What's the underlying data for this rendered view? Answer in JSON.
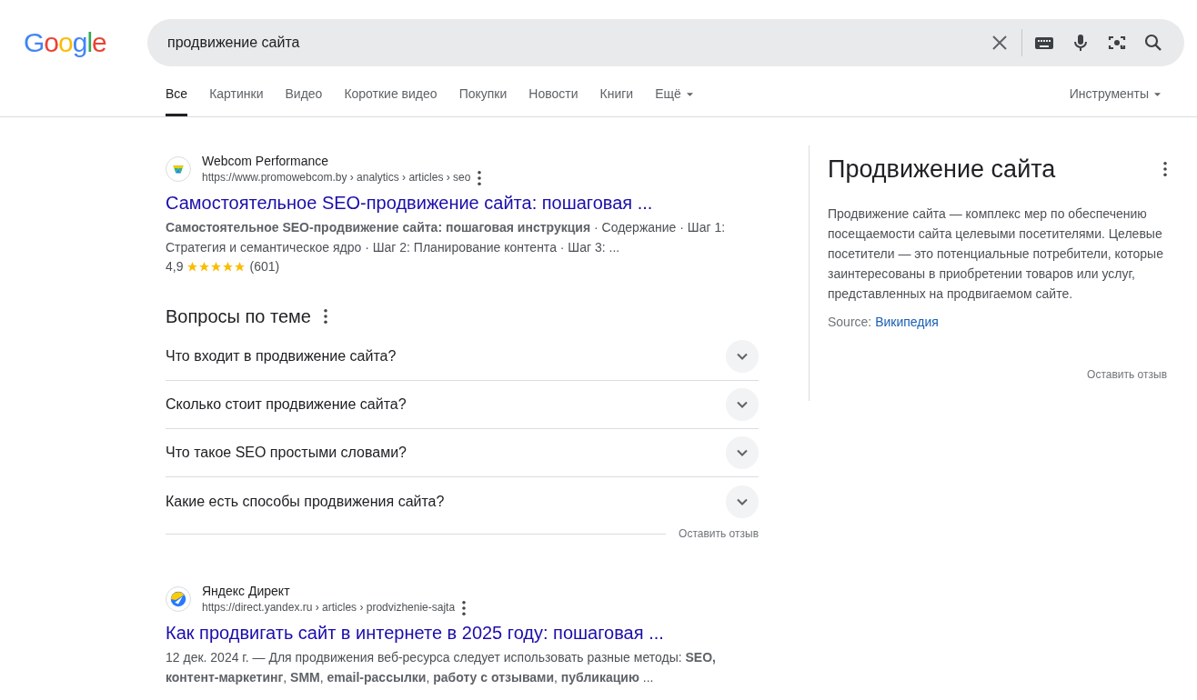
{
  "logo": {
    "text": "Google"
  },
  "search": {
    "value": "продвижение сайта"
  },
  "tabs": [
    {
      "label": "Все",
      "selected": true,
      "dropdown": false
    },
    {
      "label": "Картинки",
      "selected": false,
      "dropdown": false
    },
    {
      "label": "Видео",
      "selected": false,
      "dropdown": false
    },
    {
      "label": "Короткие видео",
      "selected": false,
      "dropdown": false
    },
    {
      "label": "Покупки",
      "selected": false,
      "dropdown": false
    },
    {
      "label": "Новости",
      "selected": false,
      "dropdown": false
    },
    {
      "label": "Книги",
      "selected": false,
      "dropdown": false
    },
    {
      "label": "Ещё",
      "selected": false,
      "dropdown": true
    }
  ],
  "tools": {
    "label": "Инструменты"
  },
  "results": [
    {
      "site": "Webcom Performance",
      "url": "https://www.promowebcom.by › analytics › articles › seo",
      "kind": "webcom",
      "title": "Самостоятельное SEO-продвижение сайта: пошаговая ...",
      "snippet": "**Самостоятельное SEO-продвижение сайта: пошаговая инструкция** · Содержание · Шаг 1: Стратегия и семантическое ядро · Шаг 2: Планирование контента · Шаг 3: ...",
      "rating": {
        "score": "4,9",
        "stars": 5,
        "count": "(601)"
      }
    },
    {
      "site": "Яндекс Директ",
      "url": "https://direct.yandex.ru › articles › prodvizhenie-sajta",
      "kind": "yandex",
      "title": "Как продвигать сайт в интернете в 2025 году: пошаговая ...",
      "snippet": "12 дек. 2024 г. — Для продвижения веб-ресурса следует использовать разные методы: **SEO, контент-маркетинг**, **SMM**, **email-рассылки**, **работу с отзывами**, **публикацию** ..."
    }
  ],
  "questions": {
    "title": "Вопросы по теме",
    "items": [
      {
        "text": "Что входит в продвижение сайта?",
        "expanded": false
      },
      {
        "text": "Сколько стоит продвижение сайта?",
        "expanded": false
      },
      {
        "text": "Что такое SEO простыми словами?",
        "expanded": false
      },
      {
        "text": "Какие есть способы продвижения сайта?",
        "expanded": false
      }
    ],
    "feedback": "Оставить отзыв"
  },
  "knowledge_panel": {
    "title": "Продвижение сайта",
    "description": "Продвижение сайта — комплекс мер по обеспечению посещаемости сайта целевыми посетителями. Целевые посетители — это потенциальные потребители, которые заинтересованы в приобретении товаров или услуг, представленных на продвигаемом сайте.",
    "source_label": "Source:",
    "source_link": "Википедия",
    "feedback": "Оставить отзыв"
  }
}
